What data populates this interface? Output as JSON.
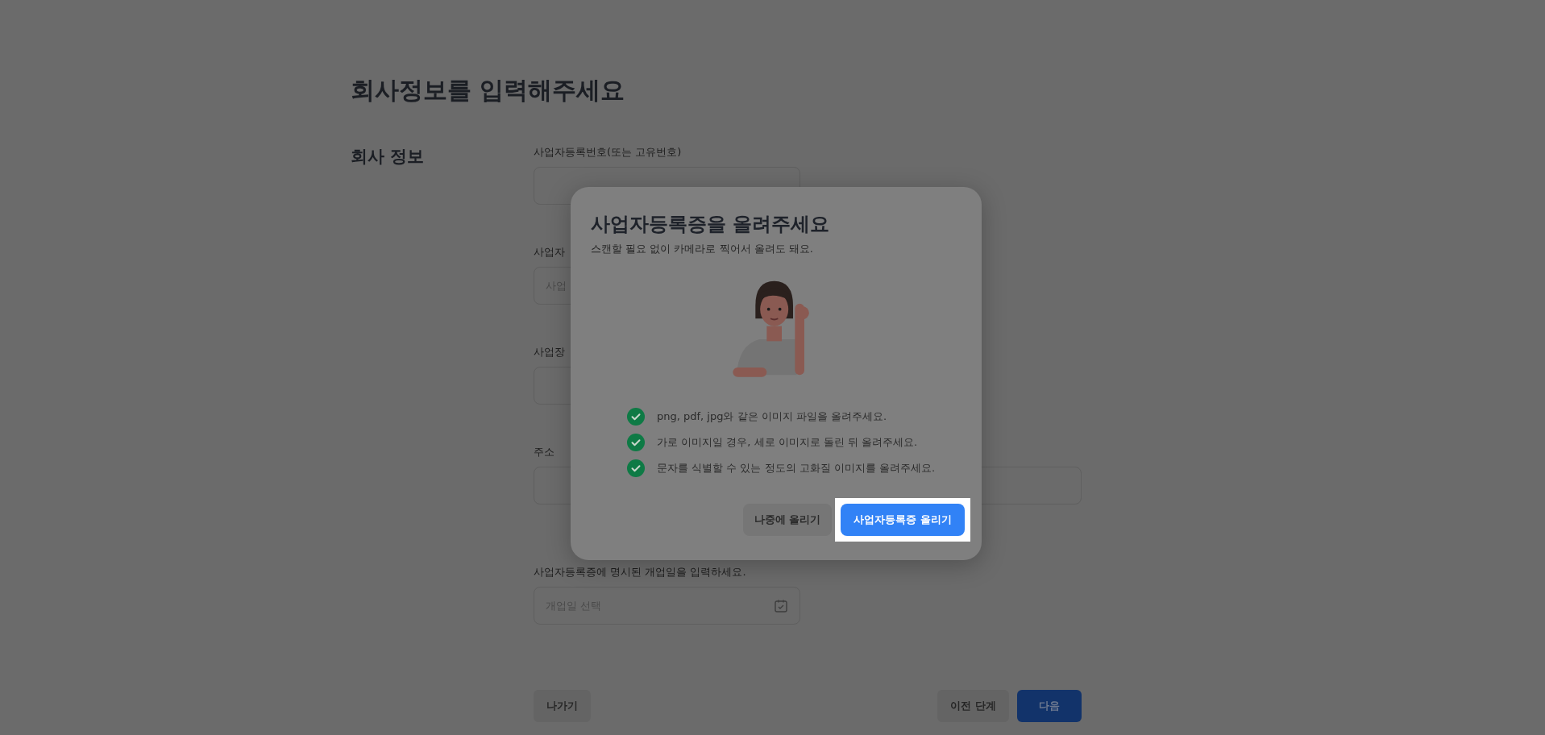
{
  "page": {
    "title": "회사정보를 입력해주세요",
    "section_title": "회사 정보"
  },
  "fields": [
    {
      "kind": "text",
      "label": "사업자등록번호(또는 고유번호)"
    },
    {
      "kind": "text",
      "label": "사업자",
      "placeholder": "사업"
    },
    {
      "kind": "text",
      "label": "사업장"
    },
    {
      "kind": "wide",
      "label": "주소"
    },
    {
      "kind": "date",
      "label": "사업자등록증에 명시된 개업일을 입력하세요.",
      "placeholder": "개업일 선택"
    }
  ],
  "footer": {
    "exit_button": "나가기",
    "back_button": "이전 단계",
    "next_button": "다음"
  },
  "modal": {
    "title": "사업자등록증을 올려주세요",
    "subtitle": "스캔할 필요 없이 카메라로 찍어서 올려도 돼요.",
    "checklist": [
      "png, pdf, jpg와 같은 이미지 파일을 올려주세요.",
      "가로 이미지일 경우, 세로 이미지로 돌린 뒤 올려주세요.",
      "문자를 식별할 수 있는 정도의 고화질 이미지를 올려주세요."
    ],
    "secondary_button": "나중에 올리기",
    "primary_button": "사업자등록증 올리기",
    "primary_highlighted": true
  }
}
